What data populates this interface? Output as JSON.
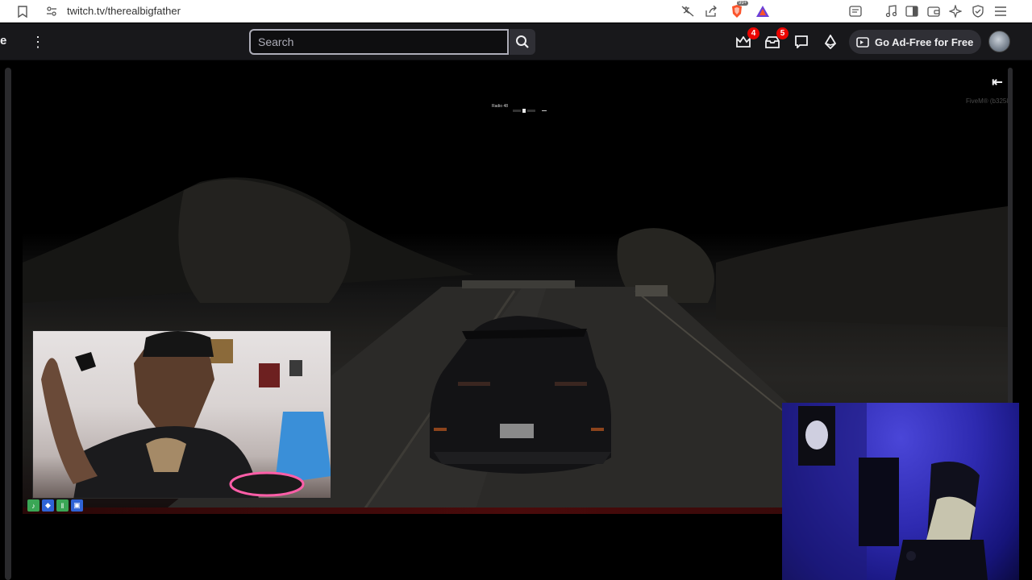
{
  "browser": {
    "url": "twitch.tv/therealbigfather",
    "icons": [
      "bookmark-icon",
      "site-settings-icon",
      "translate-off-icon",
      "share-icon",
      "brave-shields-icon",
      "brave-rewards-icon",
      "reader-mode-icon",
      "music-icon",
      "sidebar-icon",
      "wallet-icon",
      "leo-ai-icon",
      "vpn-icon",
      "menu-icon"
    ],
    "shields_badge": "99+"
  },
  "twitch_nav": {
    "brand_fragment": "e",
    "search_placeholder": "Search",
    "prime_badge": "4",
    "notifications_badge": "5",
    "ad_free_label": "Go Ad-Free for Free"
  },
  "player": {
    "hud_text": "Radio 48",
    "fivem_tag": "FiveM® (b3258)",
    "collapse_glyph": "⇤"
  },
  "colors": {
    "twitch_bg": "#18181b",
    "badge_red": "#eb0400",
    "accent_purple": "#9147ff"
  }
}
